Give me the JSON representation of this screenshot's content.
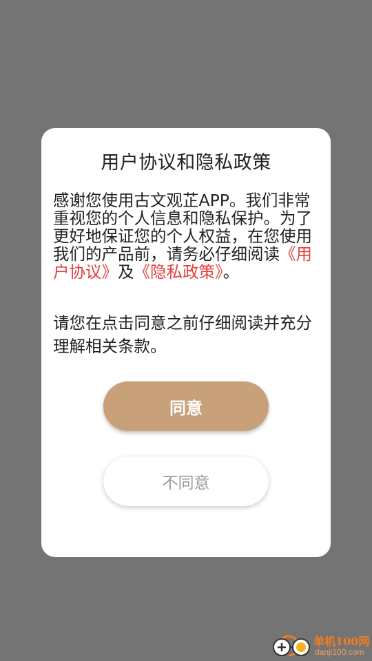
{
  "dialog": {
    "title": "用户协议和隐私政策",
    "paragraph1": {
      "prefix": "感谢您使用古文观芷APP。我们非常重视您的个人信息和隐私保护。为了更好地保证您的个人权益，在您使用我们的产品前，请务必仔细阅读",
      "user_agreement_link": "《用户协议》",
      "connector": "及",
      "privacy_policy_link": "《隐私政策》",
      "suffix": "。"
    },
    "paragraph2": "请您在点击同意之前仔细阅读并充分理解相关条款。",
    "agree_label": "同意",
    "disagree_label": "不同意"
  },
  "watermark": {
    "name": "单机100网",
    "url": "danji100.com"
  },
  "colors": {
    "overlay": "#747474",
    "dialog_bg": "#ffffff",
    "link": "#e2413b",
    "agree_button": "#c8a07a",
    "disagree_text": "#9a9a9a",
    "watermark": "#f47c20"
  },
  "icons": {
    "watermark_logo": "gamepad-logo-icon"
  }
}
